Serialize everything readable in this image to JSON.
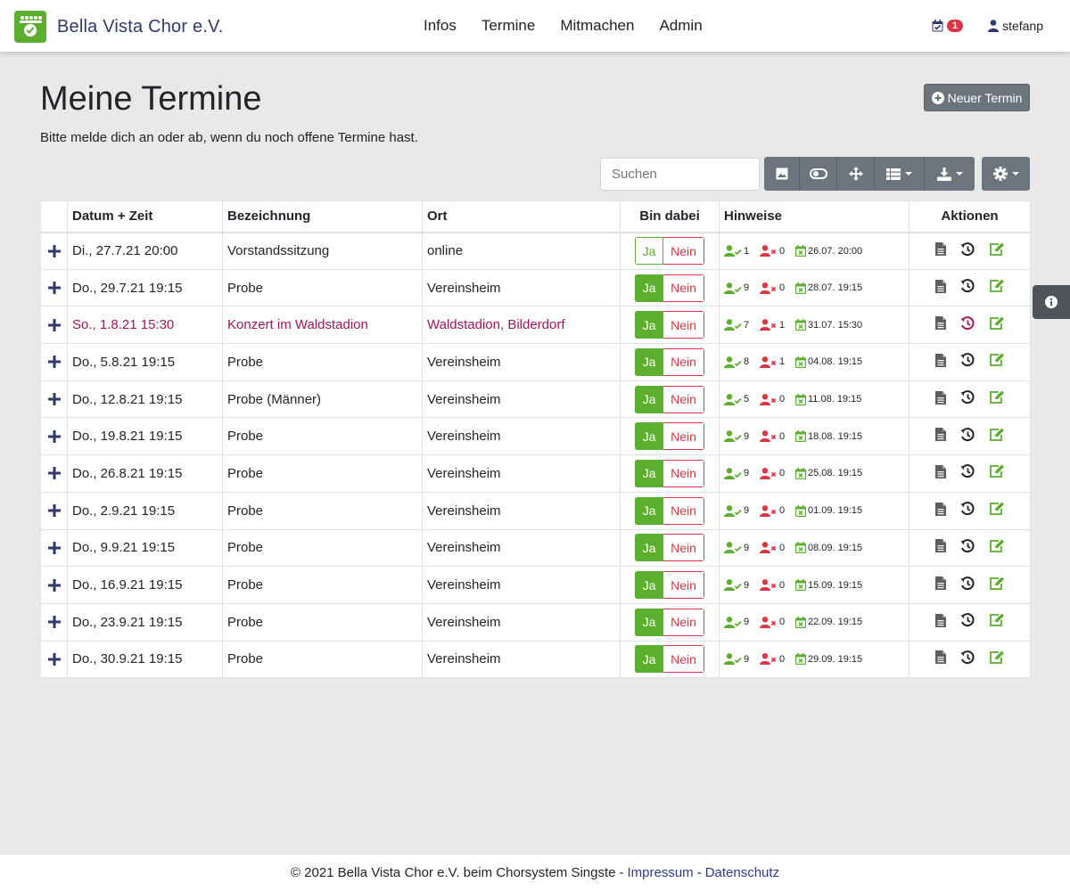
{
  "brand": {
    "name": "Bella Vista Chor e.V.",
    "logo_color": "#5cae2e"
  },
  "nav": {
    "items": [
      {
        "label": "Infos"
      },
      {
        "label": "Termine"
      },
      {
        "label": "Mitmachen"
      },
      {
        "label": "Admin"
      }
    ]
  },
  "user": {
    "name": "stefanp",
    "notification_count": "1"
  },
  "page": {
    "title": "Meine Termine",
    "subtitle": "Bitte melde dich an oder ab, wenn du noch offene Termine hast.",
    "new_button": "Neuer Termin"
  },
  "search": {
    "placeholder": "Suchen"
  },
  "table": {
    "headers": {
      "datetime": "Datum + Zeit",
      "name": "Bezeichnung",
      "location": "Ort",
      "attending": "Bin dabei",
      "hints": "Hinweise",
      "actions": "Aktionen"
    },
    "yes_label": "Ja",
    "no_label": "Nein",
    "rows": [
      {
        "datetime": "Di., 27.7.21 20:00",
        "name": "Vorstandssitzung",
        "location": "online",
        "attending": false,
        "yes": "1",
        "no": "0",
        "deadline": "26.07. 20:00",
        "highlight": false
      },
      {
        "datetime": "Do., 29.7.21 19:15",
        "name": "Probe",
        "location": "Vereinsheim",
        "attending": true,
        "yes": "9",
        "no": "0",
        "deadline": "28.07. 19:15",
        "highlight": false
      },
      {
        "datetime": "So., 1.8.21 15:30",
        "name": "Konzert im Waldstadion",
        "location": "Waldstadion, Bilderdorf",
        "attending": true,
        "yes": "7",
        "no": "1",
        "deadline": "31.07. 15:30",
        "highlight": true
      },
      {
        "datetime": "Do., 5.8.21 19:15",
        "name": "Probe",
        "location": "Vereinsheim",
        "attending": true,
        "yes": "8",
        "no": "1",
        "deadline": "04.08. 19:15",
        "highlight": false
      },
      {
        "datetime": "Do., 12.8.21 19:15",
        "name": "Probe (Männer)",
        "location": "Vereinsheim",
        "attending": true,
        "yes": "5",
        "no": "0",
        "deadline": "11.08. 19:15",
        "highlight": false
      },
      {
        "datetime": "Do., 19.8.21 19:15",
        "name": "Probe",
        "location": "Vereinsheim",
        "attending": true,
        "yes": "9",
        "no": "0",
        "deadline": "18.08. 19:15",
        "highlight": false
      },
      {
        "datetime": "Do., 26.8.21 19:15",
        "name": "Probe",
        "location": "Vereinsheim",
        "attending": true,
        "yes": "9",
        "no": "0",
        "deadline": "25.08. 19:15",
        "highlight": false
      },
      {
        "datetime": "Do., 2.9.21 19:15",
        "name": "Probe",
        "location": "Vereinsheim",
        "attending": true,
        "yes": "9",
        "no": "0",
        "deadline": "01.09. 19:15",
        "highlight": false
      },
      {
        "datetime": "Do., 9.9.21 19:15",
        "name": "Probe",
        "location": "Vereinsheim",
        "attending": true,
        "yes": "9",
        "no": "0",
        "deadline": "08.09. 19:15",
        "highlight": false
      },
      {
        "datetime": "Do., 16.9.21 19:15",
        "name": "Probe",
        "location": "Vereinsheim",
        "attending": true,
        "yes": "9",
        "no": "0",
        "deadline": "15.09. 19:15",
        "highlight": false
      },
      {
        "datetime": "Do., 23.9.21 19:15",
        "name": "Probe",
        "location": "Vereinsheim",
        "attending": true,
        "yes": "9",
        "no": "0",
        "deadline": "22.09. 19:15",
        "highlight": false
      },
      {
        "datetime": "Do., 30.9.21 19:15",
        "name": "Probe",
        "location": "Vereinsheim",
        "attending": true,
        "yes": "9",
        "no": "0",
        "deadline": "29.09. 19:15",
        "highlight": false
      }
    ]
  },
  "footer": {
    "text": "© 2021 Bella Vista Chor e.V. beim Chorsystem Singste",
    "sep1": "-",
    "impressum": "Impressum",
    "sep2": "-",
    "datenschutz": "Datenschutz"
  },
  "colors": {
    "green": "#5cae2e",
    "red": "#dc3545",
    "navy": "#2e3a6e",
    "highlight": "#a3145a",
    "gray_button": "#6c757d"
  }
}
